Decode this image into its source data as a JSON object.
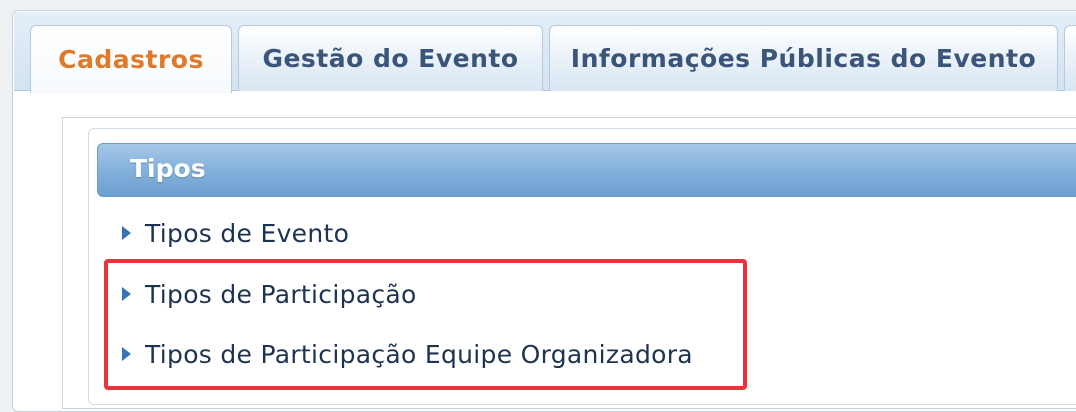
{
  "tabs": [
    {
      "label": "Cadastros",
      "active": true
    },
    {
      "label": "Gestão do Evento",
      "active": false
    },
    {
      "label": "Informações Públicas do Evento",
      "active": false
    }
  ],
  "section": {
    "title": "Tipos",
    "items": [
      {
        "label": "Tipos de Evento"
      },
      {
        "label": "Tipos de Participação"
      },
      {
        "label": "Tipos de Participação Equipe Organizadora"
      }
    ]
  },
  "colors": {
    "active_tab": "#e07a2a",
    "tab_text": "#3a5578",
    "header_blue": "#84b1dc",
    "highlight": "#e8333b"
  }
}
